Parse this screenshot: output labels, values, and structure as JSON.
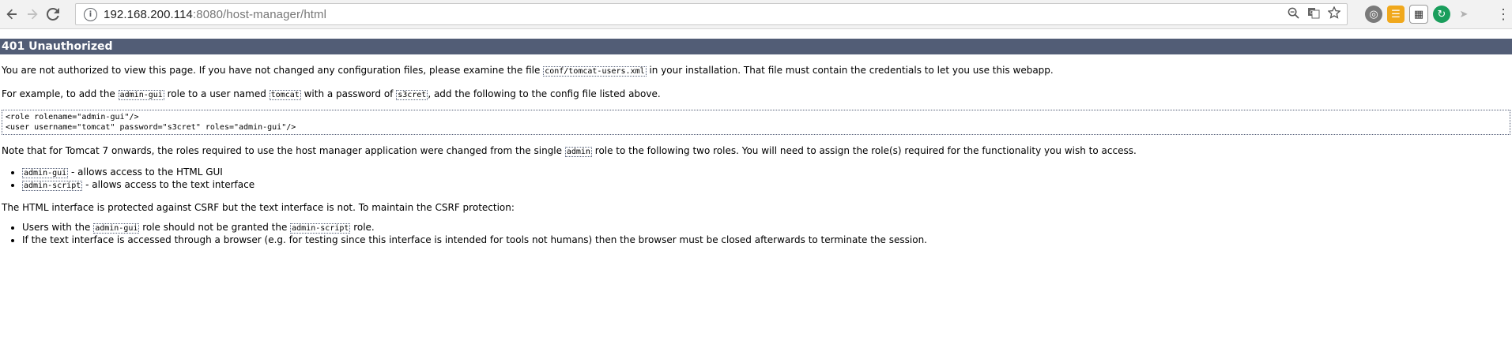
{
  "browser": {
    "url_host": "192.168.200.114",
    "url_path": ":8080/host-manager/html",
    "icons": {
      "back": "back-arrow-icon",
      "forward": "forward-arrow-icon",
      "reload": "reload-icon",
      "info": "info-icon",
      "zoom": "zoom-icon",
      "translate": "translate-icon",
      "bookmark": "star-icon",
      "menu": "more-vert-icon"
    }
  },
  "page": {
    "title": "401 Unauthorized",
    "p1_a": "You are not authorized to view this page. If you have not changed any configuration files, please examine the file ",
    "p1_code": "conf/tomcat-users.xml",
    "p1_b": " in your installation. That file must contain the credentials to let you use this webapp.",
    "p2_a": "For example, to add the ",
    "p2_code1": "admin-gui",
    "p2_b": " role to a user named ",
    "p2_code2": "tomcat",
    "p2_c": " with a password of ",
    "p2_code3": "s3cret",
    "p2_d": ", add the following to the config file listed above.",
    "pre_line1": "<role rolename=\"admin-gui\"/>",
    "pre_line2": "<user username=\"tomcat\" password=\"s3cret\" roles=\"admin-gui\"/>",
    "p3_a": "Note that for Tomcat 7 onwards, the roles required to use the host manager application were changed from the single ",
    "p3_code": "admin",
    "p3_b": " role to the following two roles. You will need to assign the role(s) required for the functionality you wish to access.",
    "roles": [
      {
        "code": "admin-gui",
        "desc": " - allows access to the HTML GUI"
      },
      {
        "code": "admin-script",
        "desc": " - allows access to the text interface"
      }
    ],
    "p4": "The HTML interface is protected against CSRF but the text interface is not. To maintain the CSRF protection:",
    "csrf_1_a": "Users with the ",
    "csrf_1_code1": "admin-gui",
    "csrf_1_b": " role should not be granted the ",
    "csrf_1_code2": "admin-script",
    "csrf_1_c": " role.",
    "csrf_2": "If the text interface is accessed through a browser (e.g. for testing since this interface is intended for tools not humans) then the browser must be closed afterwards to terminate the session."
  }
}
